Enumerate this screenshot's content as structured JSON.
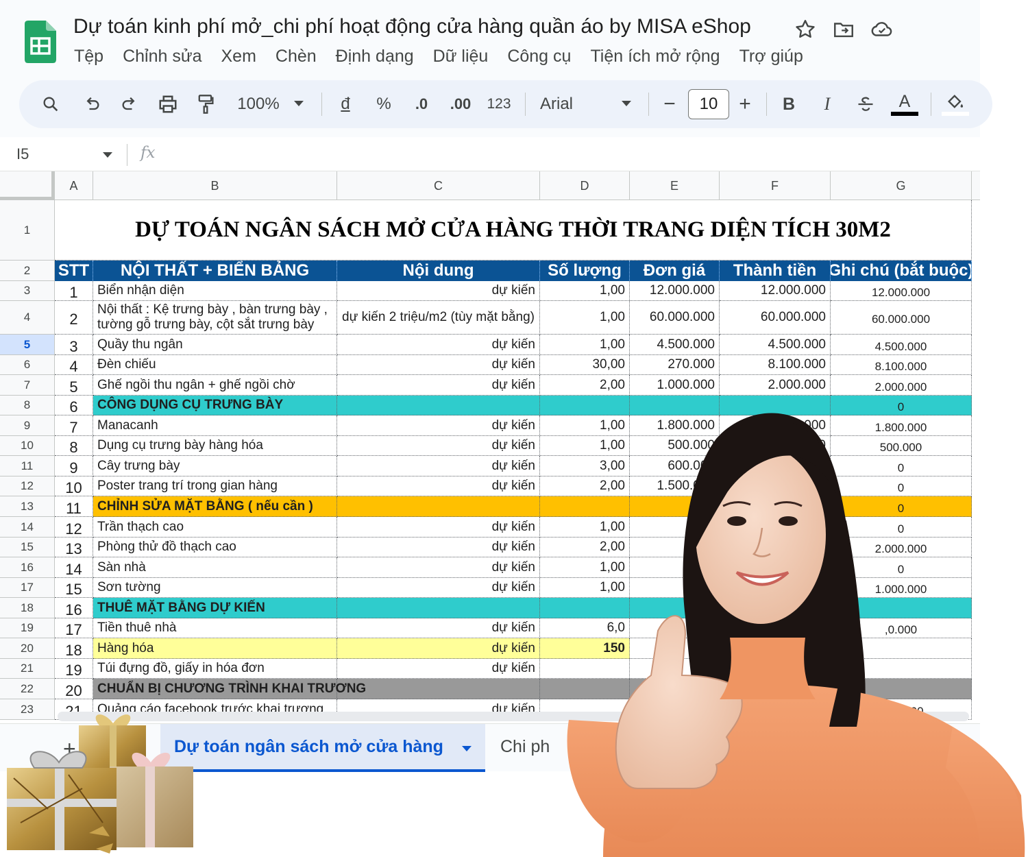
{
  "doc": {
    "title": "Dự toán kinh phí mở_chi phí hoạt động cửa hàng quần áo by MISA eShop",
    "menu": [
      "Tệp",
      "Chỉnh sửa",
      "Xem",
      "Chèn",
      "Định dạng",
      "Dữ liệu",
      "Công cụ",
      "Tiện ích mở rộng",
      "Trợ giúp"
    ]
  },
  "toolbar": {
    "zoom": "100%",
    "currency": "đ",
    "percent": "%",
    "decrease_decimal": ".0",
    "increase_decimal": ".00",
    "number_format": "123",
    "font": "Arial",
    "font_size": "10",
    "minus": "−",
    "plus": "+",
    "bold": "B",
    "italic": "I",
    "text_color": "A"
  },
  "formula_bar": {
    "cell_ref": "I5",
    "fx": "fx"
  },
  "grid": {
    "columns": [
      "A",
      "B",
      "C",
      "D",
      "E",
      "F",
      "G"
    ],
    "row_numbers": [
      "1",
      "2",
      "3",
      "4",
      "5",
      "6",
      "7",
      "8",
      "9",
      "10",
      "11",
      "12",
      "13",
      "14",
      "15",
      "16",
      "17",
      "18",
      "19",
      "20",
      "21",
      "22",
      "23"
    ],
    "selected_row": "5",
    "title": "DỰ TOÁN NGÂN SÁCH MỞ CỬA HÀNG THỜI TRANG DIỆN TÍCH 30M2",
    "header": [
      "STT",
      "NỘI THẤT + BIỂN BẢNG",
      "Nội dung",
      "Số lượng",
      "Đơn giá",
      "Thành tiền",
      "Ghi chú (bắt buộc)"
    ],
    "rows": [
      {
        "stt": "1",
        "item": "Biển nhận diện",
        "content": "dự kiến",
        "qty": "1,00",
        "price": "12.000.000",
        "total": "12.000.000",
        "note": "12.000.000"
      },
      {
        "stt": "2",
        "item": "Nội thất : Kệ trưng bày , bàn trưng bày ,",
        "item2": "tường gỗ trưng bày, cột sắt trưng bày",
        "content": "dự kiến 2 triệu/m2 (tùy mặt bằng)",
        "qty": "1,00",
        "price": "60.000.000",
        "total": "60.000.000",
        "note": "60.000.000"
      },
      {
        "stt": "3",
        "item": "Quầy thu ngân",
        "content": "dự kiến",
        "qty": "1,00",
        "price": "4.500.000",
        "total": "4.500.000",
        "note": "4.500.000"
      },
      {
        "stt": "4",
        "item": "Đèn chiếu",
        "content": "dự kiến",
        "qty": "30,00",
        "price": "270.000",
        "total": "8.100.000",
        "note": "8.100.000"
      },
      {
        "stt": "5",
        "item": "Ghế ngồi thu ngân + ghế ngồi chờ",
        "content": "dự kiến",
        "qty": "2,00",
        "price": "1.000.000",
        "total": "2.000.000",
        "note": "2.000.000"
      },
      {
        "stt": "6",
        "item": "CÔNG DỤNG CỤ TRƯNG BÀY",
        "note": "0"
      },
      {
        "stt": "7",
        "item": "Manacanh",
        "content": "dự kiến",
        "qty": "1,00",
        "price": "1.800.000",
        "total": "1.800.000",
        "note": "1.800.000"
      },
      {
        "stt": "8",
        "item": "Dụng cụ trưng bày hàng hóa",
        "content": "dự kiến",
        "qty": "1,00",
        "price": "500.000",
        "total": "500.000",
        "note": "500.000"
      },
      {
        "stt": "9",
        "item": "Cây trưng bày",
        "content": "dự kiến",
        "qty": "3,00",
        "price": "600.000",
        "total": "1.800.000",
        "note": "0"
      },
      {
        "stt": "10",
        "item": "Poster trang trí trong gian hàng",
        "content": "dự kiến",
        "qty": "2,00",
        "price": "1.500.000",
        "total": "3.000.000",
        "note": "0"
      },
      {
        "stt": "11",
        "item": "CHỈNH SỬA MẶT BẰNG ( nếu cần )",
        "note": "0"
      },
      {
        "stt": "12",
        "item": "Trần thạch cao",
        "content": "dự kiến",
        "qty": "1,00",
        "price": "8.0",
        "note": "0"
      },
      {
        "stt": "13",
        "item": "Phòng thử đồ thạch cao",
        "content": "dự kiến",
        "qty": "2,00",
        "price": "1.",
        "note": "2.000.000"
      },
      {
        "stt": "14",
        "item": "Sàn nhà",
        "content": "dự kiến",
        "qty": "1,00",
        "price": "6",
        "note": "0"
      },
      {
        "stt": "15",
        "item": "Sơn tường",
        "content": "dự kiến",
        "qty": "1,00",
        "note": "1.000.000"
      },
      {
        "stt": "16",
        "item": "THUÊ MẶT BẰNG DỰ KIẾN"
      },
      {
        "stt": "17",
        "item": "Tiền thuê nhà",
        "content": "dự kiến",
        "qty": "6,0",
        "note": ",0.000"
      },
      {
        "stt": "18",
        "item": "Hàng hóa",
        "content": "dự kiến",
        "qty": "150"
      },
      {
        "stt": "19",
        "item": "Túi đựng đồ, giấy in hóa đơn",
        "content": "dự kiến"
      },
      {
        "stt": "20",
        "item": "CHUẨN BỊ CHƯƠNG TRÌNH KHAI TRƯƠNG"
      },
      {
        "stt": "21",
        "item": "Quảng cáo facebook trước khai trương",
        "content": "dự kiến",
        "note": "5.000.00"
      }
    ]
  },
  "sheet_tabs": {
    "add": "+",
    "active": "Dự toán ngân sách mở cửa hàng",
    "others": [
      "Chi ph",
      "m nhập hà"
    ]
  },
  "colors": {
    "header_blue": "#0b5394",
    "section_teal": "#2fcccc",
    "section_amber": "#ffc000",
    "section_gray": "#999999",
    "highlight_yellow": "#ffff99",
    "sweater_orange": "#f29866"
  }
}
